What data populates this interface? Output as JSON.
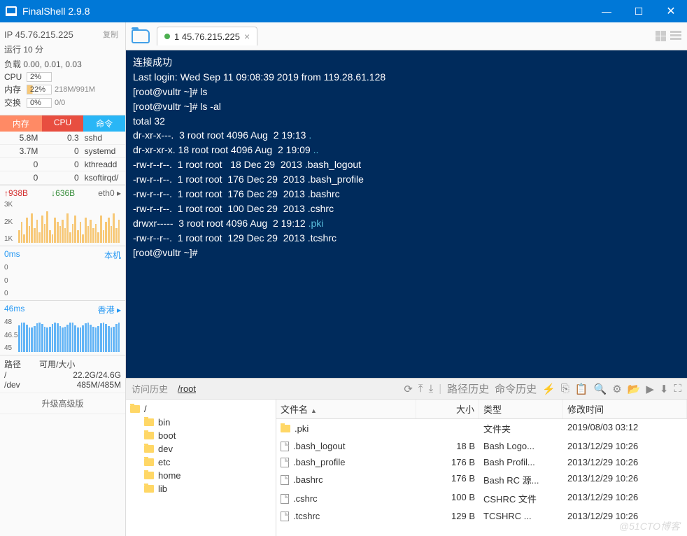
{
  "window": {
    "title": "FinalShell 2.9.8"
  },
  "sidebar": {
    "ip": "IP 45.76.215.225",
    "copy": "复制",
    "uptime": "运行 10 分",
    "load": "负载 0.00, 0.01, 0.03",
    "cpu_lbl": "CPU",
    "cpu_pct": "2%",
    "mem_lbl": "内存",
    "mem_pct": "22%",
    "mem_detail": "218M/991M",
    "swap_lbl": "交换",
    "swap_pct": "0%",
    "swap_detail": "0/0",
    "proc_headers": {
      "mem": "内存",
      "cpu": "CPU",
      "cmd": "命令"
    },
    "procs": [
      {
        "mem": "5.8M",
        "cpu": "0.3",
        "cmd": "sshd"
      },
      {
        "mem": "3.7M",
        "cpu": "0",
        "cmd": "systemd"
      },
      {
        "mem": "0",
        "cpu": "0",
        "cmd": "kthreadd"
      },
      {
        "mem": "0",
        "cpu": "0",
        "cmd": "ksoftirqd/"
      }
    ],
    "net": {
      "up": "↑938B",
      "down": "↓636B",
      "iface": "eth0 ▸",
      "ylabels": [
        "3K",
        "2K",
        "1K"
      ]
    },
    "lat1": {
      "ms": "0ms",
      "loc": "本机",
      "y": [
        "0",
        "0",
        "0"
      ]
    },
    "lat2": {
      "ms": "46ms",
      "loc": "香港 ▸",
      "y": [
        "48",
        "46.5",
        "45"
      ]
    },
    "path_h1": "路径",
    "path_h2": "可用/大小",
    "paths": [
      {
        "p": "/",
        "v": "22.2G/24.6G"
      },
      {
        "p": "/dev",
        "v": "485M/485M"
      }
    ],
    "upgrade": "升级高级版"
  },
  "tabs": {
    "tab1": "1 45.76.215.225"
  },
  "terminal": {
    "line1": "连接成功",
    "line2": "Last login: Wed Sep 11 09:08:39 2019 from 119.28.61.128",
    "line3": "[root@vultr ~]# ls",
    "line4": "[root@vultr ~]# ls -al",
    "line5": "total 32",
    "line6": "dr-xr-x---.  3 root root 4096 Aug  2 19:13 ",
    "line6b": ".",
    "line7": "dr-xr-xr-x. 18 root root 4096 Aug  2 19:09 ",
    "line7b": "..",
    "line8": "-rw-r--r--.  1 root root   18 Dec 29  2013 .bash_logout",
    "line9": "-rw-r--r--.  1 root root  176 Dec 29  2013 .bash_profile",
    "line10": "-rw-r--r--.  1 root root  176 Dec 29  2013 .bashrc",
    "line11": "-rw-r--r--.  1 root root  100 Dec 29  2013 .cshrc",
    "line12": "drwxr-----  3 root root 4096 Aug  2 19:12 ",
    "line12b": ".pki",
    "line13": "-rw-r--r--.  1 root root  129 Dec 29  2013 .tcshrc",
    "line14": "[root@vultr ~]# "
  },
  "bp": {
    "crumb1": "访问历史",
    "crumb2": "/root",
    "crumb3": "路径历史",
    "crumb4": "命令历史",
    "tree_root": "/",
    "tree": [
      "bin",
      "boot",
      "dev",
      "etc",
      "home",
      "lib"
    ],
    "cols": {
      "name": "文件名",
      "size": "大小",
      "type": "类型",
      "mtime": "修改时间"
    },
    "rows": [
      {
        "name": ".pki",
        "size": "",
        "type": "文件夹",
        "mtime": "2019/08/03 03:12",
        "folder": true
      },
      {
        "name": ".bash_logout",
        "size": "18 B",
        "type": "Bash Logo...",
        "mtime": "2013/12/29 10:26"
      },
      {
        "name": ".bash_profile",
        "size": "176 B",
        "type": "Bash Profil...",
        "mtime": "2013/12/29 10:26"
      },
      {
        "name": ".bashrc",
        "size": "176 B",
        "type": "Bash RC 源...",
        "mtime": "2013/12/29 10:26"
      },
      {
        "name": ".cshrc",
        "size": "100 B",
        "type": "CSHRC 文件",
        "mtime": "2013/12/29 10:26"
      },
      {
        "name": ".tcshrc",
        "size": "129 B",
        "type": "TCSHRC ...",
        "mtime": "2013/12/29 10:26"
      }
    ]
  },
  "watermark": "@51CTO博客"
}
